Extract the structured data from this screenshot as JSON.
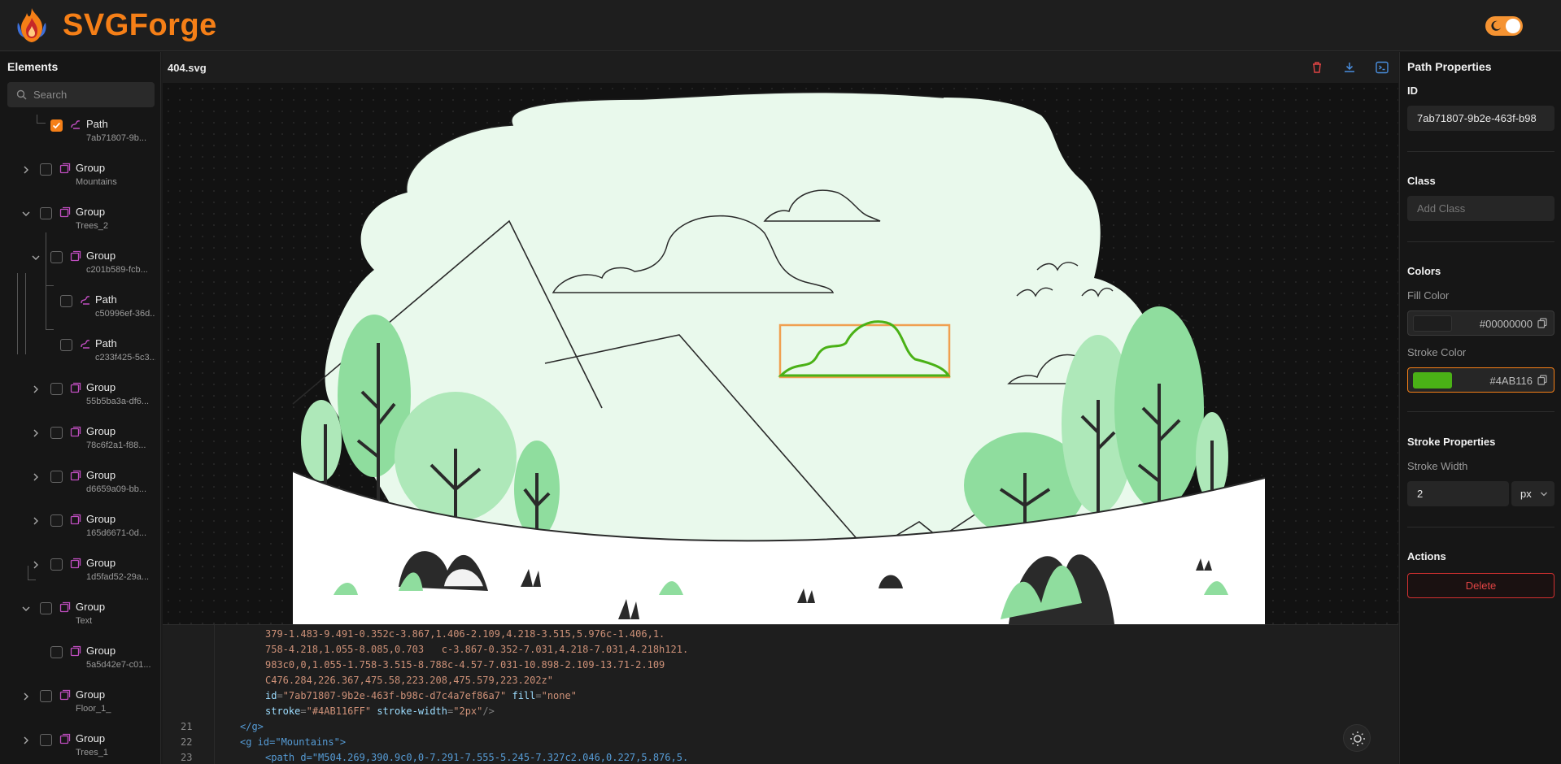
{
  "app": {
    "name": "SVGForge"
  },
  "elements_panel": {
    "title": "Elements",
    "search_placeholder": "Search",
    "items": [
      {
        "type": "Path",
        "sub": "7ab71807-9b...",
        "checked": true
      },
      {
        "type": "Group",
        "sub": "Mountains",
        "expanded": false
      },
      {
        "type": "Group",
        "sub": "Trees_2",
        "expanded": true
      },
      {
        "type": "Group",
        "sub": "c201b589-fcb...",
        "expanded": true
      },
      {
        "type": "Path",
        "sub": "c50996ef-36d..."
      },
      {
        "type": "Path",
        "sub": "c233f425-5c3..."
      },
      {
        "type": "Group",
        "sub": "55b5ba3a-df6...",
        "expanded": false
      },
      {
        "type": "Group",
        "sub": "78c6f2a1-f88...",
        "expanded": false
      },
      {
        "type": "Group",
        "sub": "d6659a09-bb...",
        "expanded": false
      },
      {
        "type": "Group",
        "sub": "165d6671-0d...",
        "expanded": false
      },
      {
        "type": "Group",
        "sub": "1d5fad52-29a...",
        "expanded": false
      },
      {
        "type": "Group",
        "sub": "Text",
        "expanded": true
      },
      {
        "type": "Group",
        "sub": "5a5d42e7-c01..."
      },
      {
        "type": "Group",
        "sub": "Floor_1_",
        "expanded": false
      },
      {
        "type": "Group",
        "sub": "Trees_1",
        "expanded": false
      }
    ]
  },
  "editor": {
    "filename": "404.svg",
    "code_lines": [
      {
        "n": "",
        "text": "379-1.483-9.491-0.352c-3.867,1.406-2.109,4.218-3.515,5.976c-1.406,1."
      },
      {
        "n": "",
        "text": "758-4.218,1.055-8.085,0.703   c-3.867-0.352-7.031,4.218-7.031,4.218h121."
      },
      {
        "n": "",
        "text": "983c0,0,1.055-1.758-3.515-8.788c-4.57-7.031-10.898-2.109-13.71-2.109"
      },
      {
        "n": "",
        "text": "C476.284,226.367,475.58,223.208,475.579,223.202z\""
      },
      {
        "n": "",
        "attr1": "id",
        "val1": "\"7ab71807-9b2e-463f-b98c-d7c4a7ef86a7\"",
        "attr2": "fill",
        "val2": "\"none\""
      },
      {
        "n": "",
        "attr1": "stroke",
        "val1": "\"#4AB116FF\"",
        "attr2": "stroke-width",
        "val2": "\"2px\"",
        "tail": "/>"
      },
      {
        "n": "21",
        "text": "</g>"
      },
      {
        "n": "22",
        "text": "<g id=\"Mountains\">"
      },
      {
        "n": "23",
        "text": "<path d=\"M504.269,390.9c0,0-7.291-7.555-5.245-7.327c2.046,0.227,5.876,5."
      }
    ]
  },
  "properties": {
    "title": "Path Properties",
    "id_label": "ID",
    "id_value": "7ab71807-9b2e-463f-b98",
    "class_label": "Class",
    "class_placeholder": "Add Class",
    "colors_label": "Colors",
    "fill_label": "Fill Color",
    "fill_hex": "#00000000",
    "fill_swatch": "#1e1e1e",
    "stroke_label": "Stroke Color",
    "stroke_hex": "#4AB116",
    "stroke_swatch": "#4ab116",
    "stroke_props_label": "Stroke Properties",
    "stroke_width_label": "Stroke Width",
    "stroke_width_value": "2",
    "stroke_width_unit": "px",
    "actions_label": "Actions",
    "delete_label": "Delete"
  },
  "colors": {
    "accent": "#f57f17",
    "selection": "#f0a050",
    "illustration_bg": "#e9f9ec",
    "leaf": "#8fdd9e",
    "leaf_dark": "#aee8b9",
    "stroke_green": "#4ab116"
  }
}
